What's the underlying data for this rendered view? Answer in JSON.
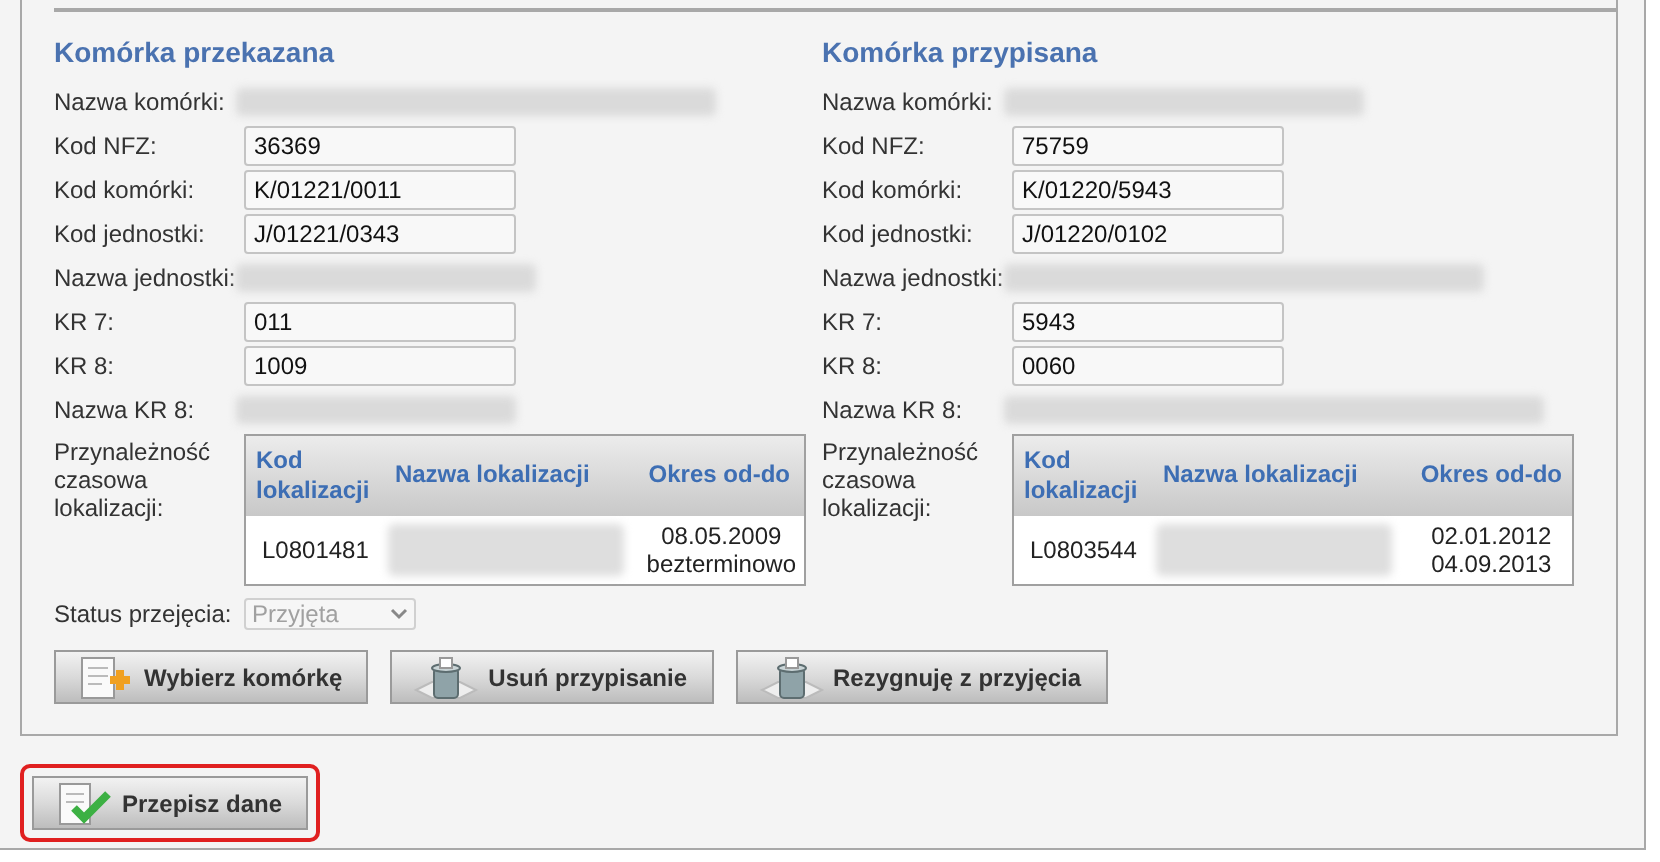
{
  "columns": [
    {
      "heading": "Komórka przekazana",
      "fields": [
        {
          "label": "Nazwa komórki:",
          "kind": "redacted"
        },
        {
          "label": "Kod NFZ:",
          "kind": "input",
          "value": "36369"
        },
        {
          "label": "Kod komórki:",
          "kind": "input",
          "value": "K/01221/0011"
        },
        {
          "label": "Kod jednostki:",
          "kind": "input",
          "value": "J/01221/0343"
        },
        {
          "label": "Nazwa jednostki:",
          "kind": "redacted"
        },
        {
          "label": "KR 7:",
          "kind": "input",
          "value": "011"
        },
        {
          "label": "KR 8:",
          "kind": "input",
          "value": "1009"
        },
        {
          "label": "Nazwa KR 8:",
          "kind": "redacted"
        }
      ],
      "locations_label": "Przynależność czasowa lokalizacji:",
      "locations": {
        "columns": [
          "Kod lokalizacji",
          "Nazwa lokalizacji",
          "Okres od-do"
        ],
        "rows": [
          {
            "code": "L0801481",
            "period": [
              "08.05.2009",
              "bezterminowo"
            ]
          }
        ]
      },
      "status": {
        "label": "Status przejęcia:",
        "value": "Przyjęta",
        "disabled": true
      }
    },
    {
      "heading": "Komórka przypisana",
      "fields": [
        {
          "label": "Nazwa komórki:",
          "kind": "redacted"
        },
        {
          "label": "Kod NFZ:",
          "kind": "input",
          "value": "75759"
        },
        {
          "label": "Kod komórki:",
          "kind": "input",
          "value": "K/01220/5943"
        },
        {
          "label": "Kod jednostki:",
          "kind": "input",
          "value": "J/01220/0102"
        },
        {
          "label": "Nazwa jednostki:",
          "kind": "redacted"
        },
        {
          "label": "KR 7:",
          "kind": "input",
          "value": "5943"
        },
        {
          "label": "KR 8:",
          "kind": "input",
          "value": "0060"
        },
        {
          "label": "Nazwa KR 8:",
          "kind": "redacted"
        }
      ],
      "locations_label": "Przynależność czasowa lokalizacji:",
      "locations": {
        "columns": [
          "Kod lokalizacji",
          "Nazwa lokalizacji",
          "Okres od-do"
        ],
        "rows": [
          {
            "code": "L0803544",
            "period": [
              "02.01.2012",
              "04.09.2013"
            ]
          }
        ]
      }
    }
  ],
  "actions": [
    {
      "label": "Wybierz komórkę",
      "kind": "add"
    },
    {
      "label": "Usuń przypisanie",
      "kind": "trash"
    },
    {
      "label": "Rezygnuję z przyjęcia",
      "kind": "trash"
    }
  ],
  "submit": {
    "label": "Przepisz dane",
    "highlighted": true
  }
}
